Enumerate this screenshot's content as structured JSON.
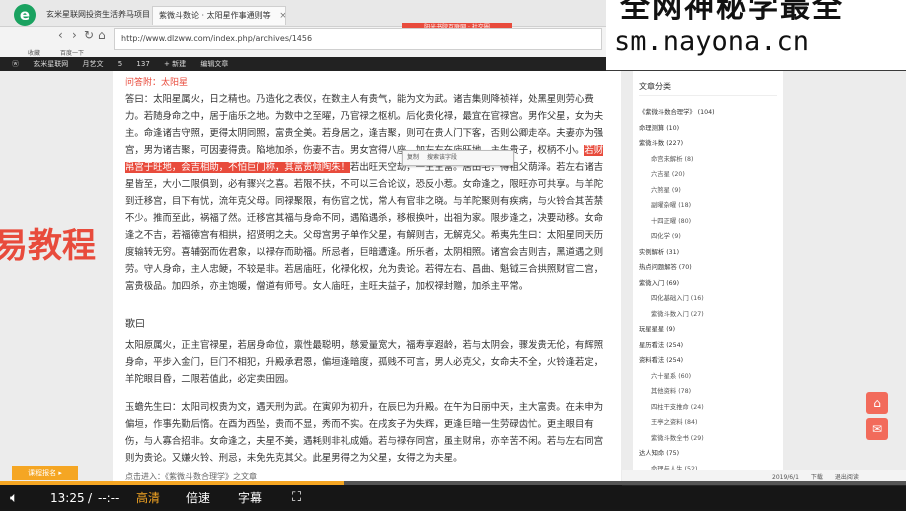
{
  "browser": {
    "tabs": [
      {
        "label": "玄米星联网投资生活养马项目"
      },
      {
        "label": "紫微斗数论 · 太阳星作事通则等"
      }
    ],
    "address": "http://www.dlzww.com/index.php/archives/1456",
    "bookmarks": [
      "收藏",
      "百度一下"
    ],
    "red_badge": "阳光书院互联网 · 社交圈"
  },
  "wpbar": {
    "items": [
      "玄米星联网",
      "月艺文",
      "5",
      "137",
      "+ 新建",
      "编辑文章"
    ]
  },
  "watermark": {
    "line1": "全网神秘学最全",
    "line2": "sm.nayona.cn"
  },
  "side_overlay": {
    "text": "易教程"
  },
  "article": {
    "top_cut": "问答附：太阳星",
    "p1_before": "答曰：太阳星属火，日之精也。乃造化之表仪，在数主人有贵气，能为文为武。诸吉集则降祯祥，处黑星则劳心费力。若随身命之中，居于庙乐之地。为数中之至曜，乃官禄之枢机。后化贵化禄，最宜在官禄宫。男作父星，女为夫主。命逢诸吉守照，更得太阴同照，富贵全美。若身居之，逢吉聚，则可在贵人门下客，否则公卿走卒。夫妻亦为强宫，男为诸吉聚，可因妻得贵。陷地加杀，伤妻不吉。男女宫得八座，加左右在庙旺地，主生贵子，权柄不小。",
    "p1_highlight": "若财帛宫于旺地，会吉相助，不怕巨门称，其富贵倾陶朱！",
    "p1_after": "若出旺天空劫，一生主富。居田宅，得祖父荫泽。若左右诸吉星皆至，大小二限俱到，必有骤兴之喜。若限不扶，不可以三合论议，恐反小惹。女命逢之，限旺亦可共享。与羊陀到迁移宫，目下有忧，流年克父母。同禄聚限，有伤官之忧，常人有官非之晓。与羊陀聚则有疾病，与火铃合其苦禁不少。推而至此，祸福了然。迁移宫其福与身命不同，遇陷遇杀，移根换叶，出祖为家。限步逢之，决要动移。女命逢之不吉，若福德宫有相拱，招贤明之夫。父母宫男子单作父星，有解则吉，无解克父。希夷先生曰：太阳星同天历度输转无穷。喜辅弼而佐君象，以禄存而助福。所忌者，巨暗遭逢。所乐者，太阴相照。诸宫会吉则吉，黑道遇之则劳。守人身命，主人忠鲠，不较是非。若居庙旺，化禄化权，允为贵论。若得左右、昌曲、魁钺三合拱照财官二宫，富贵极品。加四杀，亦主饱暖，僧道有师号。女人庙旺，主旺夫益子，加权禄封赠，加杀主平常。",
    "heading_song": "歌曰",
    "p2": "太阳原属火，正主官禄星，若居身命位，禀性最聪明，慈爱量宽大，福寿享遐龄，若与太阴会，骤发贵无伦，有辉照身命，平步入金门，巨门不相犯，升殿承君恩，偏垣逢暗度，孤贱不可言，男人必克父，女命夫不全，火铃逢若定，羊陀眼目昏，二限若值此，必定卖田园。",
    "p3": "玉蟾先生曰：太阳司权贵为文，遇天刑为武。在寅卯为初升，在辰巳为升殿。在午为日丽中天，主大富贵。在未申为偏垣，作事先勤后惰。在酉为西坠，贵而不显，秀而不实。在戌亥子为失辉，更逢巨暗一生劳碌齿忙。更主眼目有伤，与人寡合招非。女命逢之，夫星不美，遇耗则非礼成婚。若与禄存同宫，虽主财帛，亦辛苦不闲。若与左右同宫则为贵论。又嫌火铃、刑忌，未免先克其父。此星男得之为父星，女得之为夫星。",
    "bottom_cut": "点击进入：《紫微斗数合理学》之文章"
  },
  "tooltip": {
    "items": [
      "复制",
      "搜索该字段"
    ]
  },
  "sidebar": {
    "title": "文章分类",
    "items": [
      {
        "label": "《紫微斗数合理学》 (104)",
        "sub": false
      },
      {
        "label": "命理测算 (10)",
        "sub": false
      },
      {
        "label": "紫微斗数 (227)",
        "sub": false
      },
      {
        "label": "命宫未解析 (8)",
        "sub": true
      },
      {
        "label": "六吉星 (20)",
        "sub": true
      },
      {
        "label": "六煞星 (9)",
        "sub": true
      },
      {
        "label": "副曜杂曜 (18)",
        "sub": true
      },
      {
        "label": "十四正曜 (80)",
        "sub": true
      },
      {
        "label": "四化学 (9)",
        "sub": true
      },
      {
        "label": "实例解析 (31)",
        "sub": false
      },
      {
        "label": "热点问题解答 (70)",
        "sub": false
      },
      {
        "label": "紫微入门 (69)",
        "sub": false
      },
      {
        "label": "四化基础入门 (16)",
        "sub": true
      },
      {
        "label": "紫微斗数入门 (27)",
        "sub": true
      },
      {
        "label": "玩星星星 (9)",
        "sub": false
      },
      {
        "label": "星历看法 (254)",
        "sub": false
      },
      {
        "label": "资料看法 (254)",
        "sub": false
      },
      {
        "label": "六十星系 (60)",
        "sub": true
      },
      {
        "label": "其他资料 (78)",
        "sub": true
      },
      {
        "label": "四柱干支推命 (24)",
        "sub": true
      },
      {
        "label": "王亭之资料 (84)",
        "sub": true
      },
      {
        "label": "紫微斗数全书 (29)",
        "sub": true
      },
      {
        "label": "达人知命 (75)",
        "sub": false
      },
      {
        "label": "命理与人生 (52)",
        "sub": true
      }
    ]
  },
  "ad": {
    "label": "课程报名 ▸"
  },
  "dlbar": {
    "items": [
      "2019/6/1",
      "下载",
      "退出阅读"
    ]
  },
  "player": {
    "time_current": "13:25",
    "time_sep": "/",
    "time_total": "--:--",
    "quality": "高清",
    "speed": "倍速",
    "subtitle": "字幕",
    "progress_fraction": 0.38,
    "accent": "#f5a623"
  }
}
